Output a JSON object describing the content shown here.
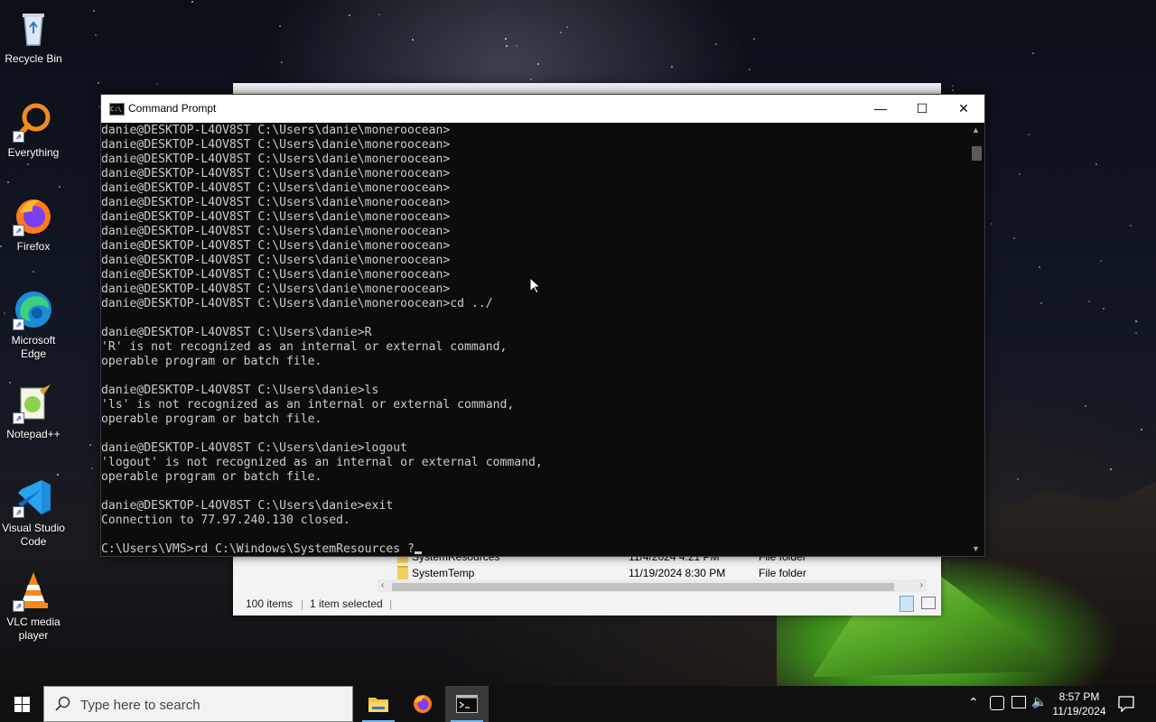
{
  "desktop": {
    "icons": [
      {
        "label": "Recycle Bin",
        "icon": "recycle-bin-icon"
      },
      {
        "label": "Everything",
        "icon": "everything-search-icon"
      },
      {
        "label": "Firefox",
        "icon": "firefox-icon"
      },
      {
        "label": "Microsoft Edge",
        "icon": "edge-icon"
      },
      {
        "label": "Notepad++",
        "icon": "notepad-plus-plus-icon"
      },
      {
        "label": "Visual Studio Code",
        "icon": "vscode-icon"
      },
      {
        "label": "VLC media player",
        "icon": "vlc-icon"
      }
    ]
  },
  "explorer": {
    "rows": [
      {
        "name": "SystemResources",
        "date": "11/4/2024 4:21 PM",
        "type": "File folder"
      },
      {
        "name": "SystemTemp",
        "date": "11/19/2024 8:30 PM",
        "type": "File folder"
      }
    ],
    "status_items": "100 items",
    "status_selected": "1 item selected"
  },
  "cmd": {
    "title": "Command Prompt",
    "lines": [
      "danie@DESKTOP-L4OV8ST C:\\Users\\danie\\moneroocean>",
      "danie@DESKTOP-L4OV8ST C:\\Users\\danie\\moneroocean>",
      "danie@DESKTOP-L4OV8ST C:\\Users\\danie\\moneroocean>",
      "danie@DESKTOP-L4OV8ST C:\\Users\\danie\\moneroocean>",
      "danie@DESKTOP-L4OV8ST C:\\Users\\danie\\moneroocean>",
      "danie@DESKTOP-L4OV8ST C:\\Users\\danie\\moneroocean>",
      "danie@DESKTOP-L4OV8ST C:\\Users\\danie\\moneroocean>",
      "danie@DESKTOP-L4OV8ST C:\\Users\\danie\\moneroocean>",
      "danie@DESKTOP-L4OV8ST C:\\Users\\danie\\moneroocean>",
      "danie@DESKTOP-L4OV8ST C:\\Users\\danie\\moneroocean>",
      "danie@DESKTOP-L4OV8ST C:\\Users\\danie\\moneroocean>",
      "danie@DESKTOP-L4OV8ST C:\\Users\\danie\\moneroocean>",
      "danie@DESKTOP-L4OV8ST C:\\Users\\danie\\moneroocean>cd ../",
      "",
      "danie@DESKTOP-L4OV8ST C:\\Users\\danie>R",
      "'R' is not recognized as an internal or external command,",
      "operable program or batch file.",
      "",
      "danie@DESKTOP-L4OV8ST C:\\Users\\danie>ls",
      "'ls' is not recognized as an internal or external command,",
      "operable program or batch file.",
      "",
      "danie@DESKTOP-L4OV8ST C:\\Users\\danie>logout",
      "'logout' is not recognized as an internal or external command,",
      "operable program or batch file.",
      "",
      "danie@DESKTOP-L4OV8ST C:\\Users\\danie>exit",
      "Connection to 77.97.240.130 closed.",
      ""
    ],
    "current_input": "C:\\Users\\VMS>rd C:\\Windows\\SystemResources ?"
  },
  "taskbar": {
    "search_placeholder": "Type here to search",
    "apps": [
      {
        "icon": "file-explorer-icon",
        "active": false
      },
      {
        "icon": "firefox-icon",
        "active": false
      },
      {
        "icon": "command-prompt-icon",
        "active": true
      }
    ],
    "time": "8:57 PM",
    "date": "11/19/2024"
  }
}
